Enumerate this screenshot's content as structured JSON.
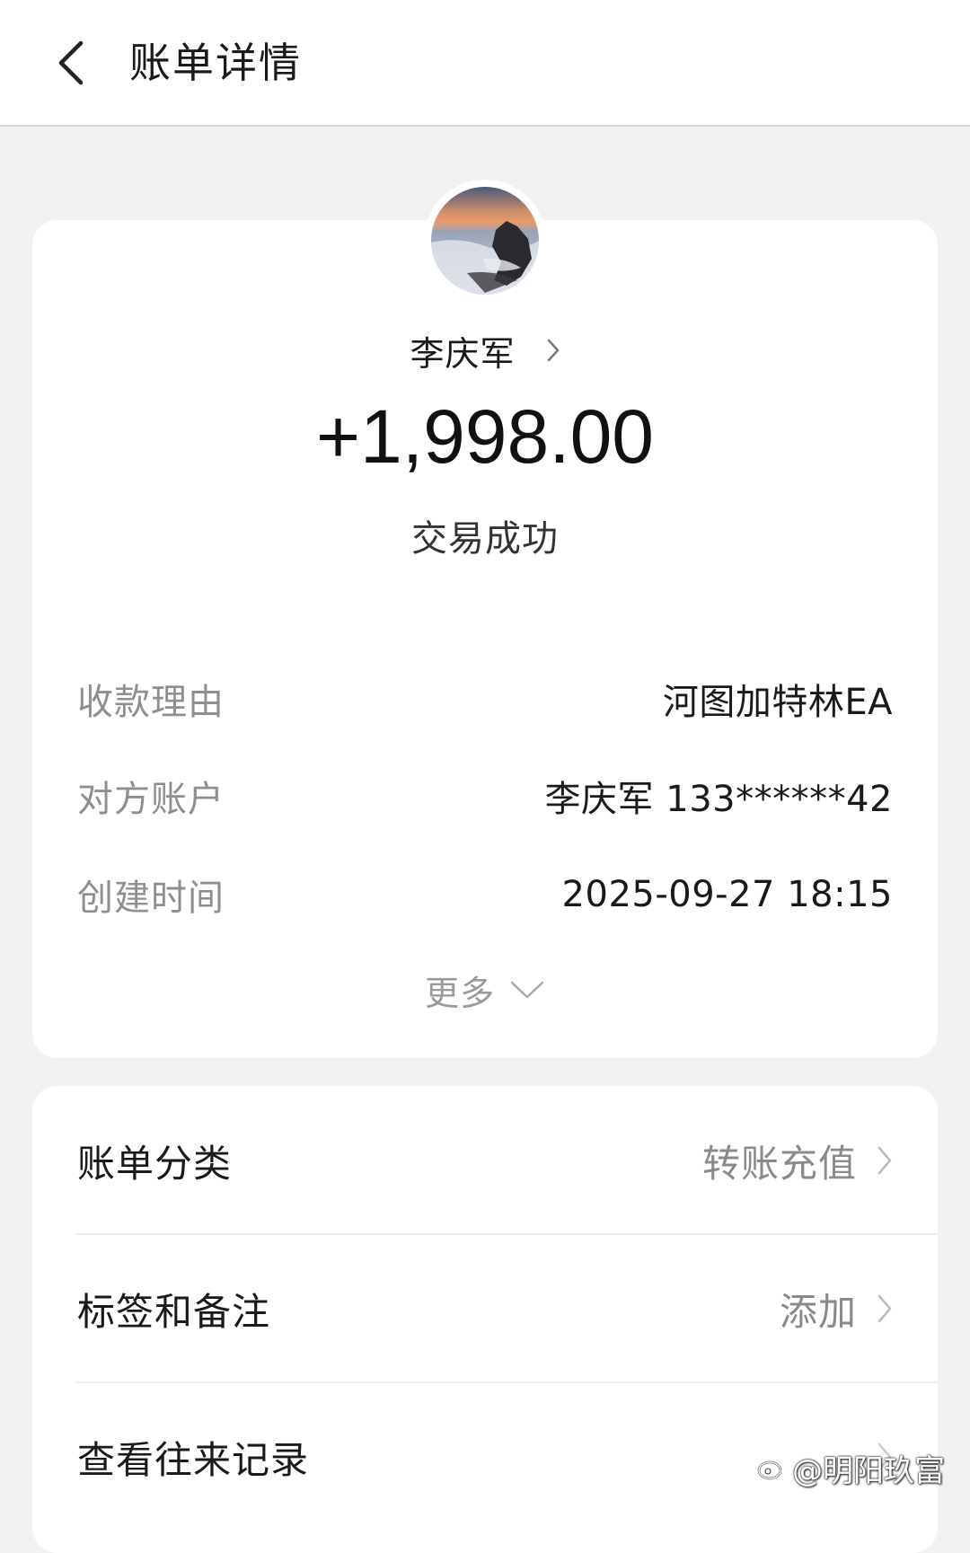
{
  "header": {
    "title": "账单详情"
  },
  "payer": {
    "name": "李庆军",
    "amount": "+1,998.00",
    "status": "交易成功"
  },
  "details": [
    {
      "label": "收款理由",
      "value": "河图加特林EA"
    },
    {
      "label": "对方账户",
      "value": "李庆军 133******42"
    },
    {
      "label": "创建时间",
      "value": "2025-09-27 18:15"
    }
  ],
  "more": {
    "label": "更多"
  },
  "list": [
    {
      "label": "账单分类",
      "value": "转账充值"
    },
    {
      "label": "标签和备注",
      "value": "添加"
    },
    {
      "label": "查看往来记录",
      "value": ""
    }
  ],
  "watermark": {
    "text": "@明阳玖富"
  },
  "colors": {
    "background": "#f2f2f2",
    "card": "#ffffff",
    "primary_text": "#1a1a1a",
    "secondary_text": "#8f8f8f"
  },
  "icons": {
    "back": "chevron-left-icon",
    "payer_link": "chevron-right-icon",
    "more": "chevron-down-icon",
    "row": "chevron-right-icon"
  }
}
